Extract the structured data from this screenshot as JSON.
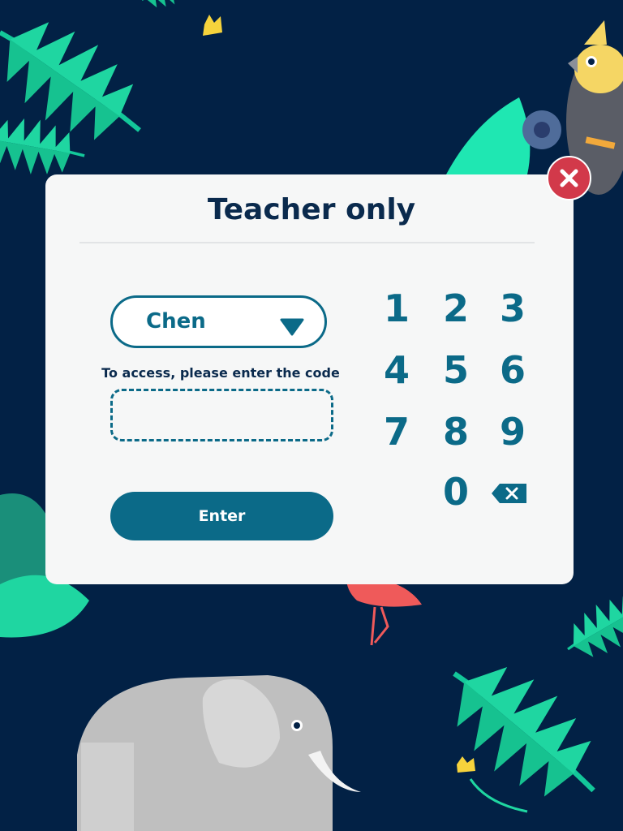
{
  "dialog": {
    "title": "Teacher only",
    "teacher_select": {
      "selected": "Chen"
    },
    "hint": "To access, please enter the code",
    "code_input": {
      "value": "",
      "placeholder": ""
    },
    "enter_label": "Enter"
  },
  "keypad": {
    "keys": [
      "1",
      "2",
      "3",
      "4",
      "5",
      "6",
      "7",
      "8",
      "9",
      "0"
    ],
    "backspace_icon": "backspace-icon"
  },
  "icons": {
    "close": "close-icon",
    "dropdown": "triangle-down-icon"
  },
  "colors": {
    "background": "#022145",
    "accent": "#0b6a88",
    "close": "#d2394a",
    "leaf": "#1fd6a1"
  }
}
